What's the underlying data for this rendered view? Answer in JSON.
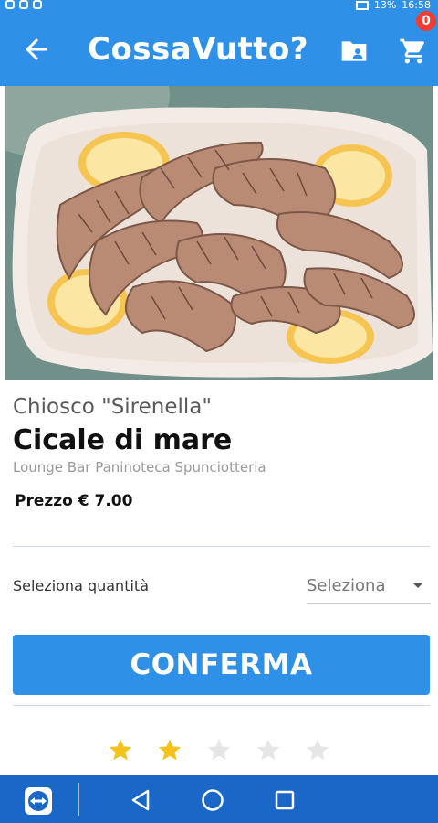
{
  "status_bar": {
    "battery": "13%",
    "time": "16:58"
  },
  "app_bar": {
    "title": "CossaVutto?",
    "cart_count": "0"
  },
  "product": {
    "kiosk": "Chiosco \"Sirenella\"",
    "name": "Cicale di mare",
    "category": "Lounge Bar Paninoteca Spunciotteria",
    "price": "Prezzo € 7.00"
  },
  "quantity": {
    "label": "Seleziona quantità",
    "placeholder": "Seleziona"
  },
  "confirm_label": "CONFERMA",
  "rating": {
    "value": 2,
    "max": 5
  },
  "colors": {
    "primary": "#2f90e8",
    "nav": "#1b67c7",
    "star_on": "#f5c21b",
    "star_off": "#e6e6e6",
    "badge": "#f23c2f"
  }
}
